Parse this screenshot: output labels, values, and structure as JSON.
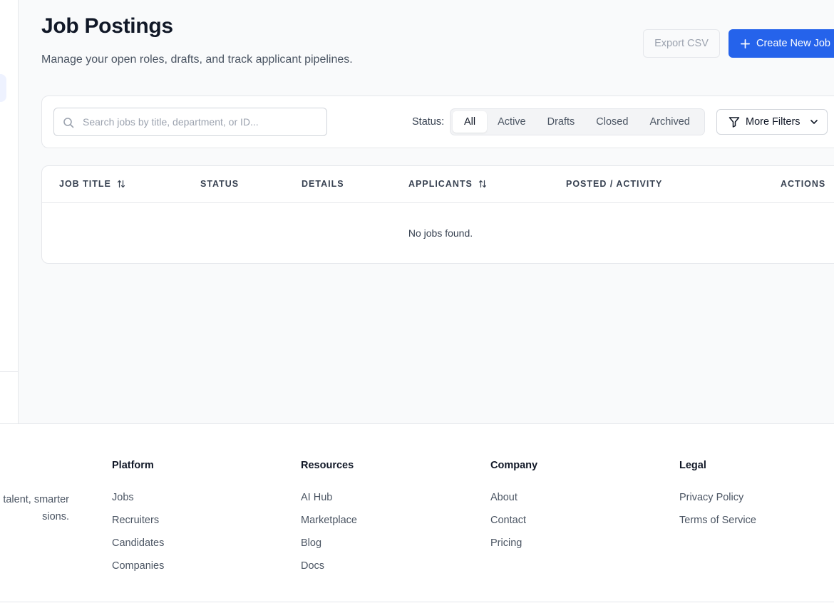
{
  "header": {
    "title": "Job Postings",
    "subtitle": "Manage your open roles, drafts, and track applicant pipelines.",
    "export_label": "Export CSV",
    "create_label": "Create New Job"
  },
  "filters": {
    "search_placeholder": "Search jobs by title, department, or ID...",
    "search_value": "",
    "status_label": "Status:",
    "status_options": [
      "All",
      "Active",
      "Drafts",
      "Closed",
      "Archived"
    ],
    "selected_status": "All",
    "more_filters_label": "More Filters"
  },
  "table": {
    "columns": [
      "JOB TITLE",
      "STATUS",
      "DETAILS",
      "APPLICANTS",
      "POSTED / ACTIVITY",
      "ACTIONS"
    ],
    "empty_message": "No jobs found."
  },
  "footer": {
    "tagline": "l talent, smarter sions.",
    "tagline_lines": [
      "l talent, smarter",
      "sions."
    ],
    "columns": [
      {
        "title": "Platform",
        "links": [
          "Jobs",
          "Recruiters",
          "Candidates",
          "Companies"
        ]
      },
      {
        "title": "Resources",
        "links": [
          "AI Hub",
          "Marketplace",
          "Blog",
          "Docs"
        ]
      },
      {
        "title": "Company",
        "links": [
          "About",
          "Contact",
          "Pricing"
        ]
      },
      {
        "title": "Legal",
        "links": [
          "Privacy Policy",
          "Terms of Service"
        ]
      }
    ]
  },
  "colors": {
    "accent": "#2563eb",
    "page_bg": "#f9fafb",
    "border": "#e5e7eb",
    "text_primary": "#111827",
    "text_secondary": "#4b5563"
  }
}
